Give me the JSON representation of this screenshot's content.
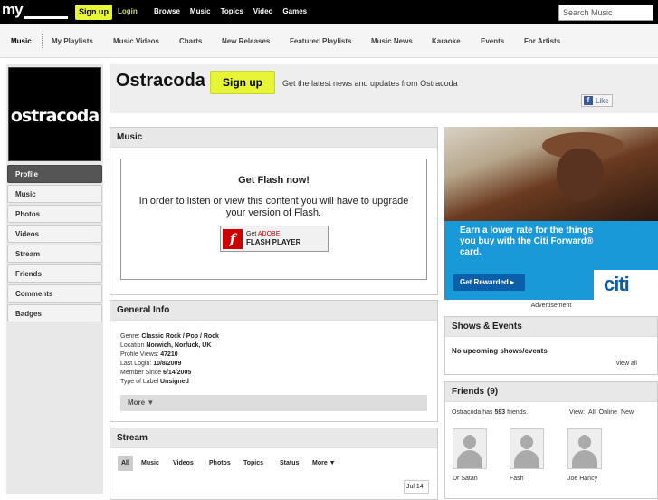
{
  "topbar": {
    "signup_label": "Sign up",
    "login_label": "Login",
    "nav": [
      "Browse",
      "Music",
      "Topics",
      "Video",
      "Games"
    ],
    "search_placeholder": "Search Music"
  },
  "subnav": [
    "Music",
    "My Playlists",
    "Music Videos",
    "Charts",
    "New Releases",
    "Featured Playlists",
    "Music News",
    "Karaoke",
    "Events",
    "For Artists"
  ],
  "sidebar": {
    "logo_text": "ostracoda",
    "items": [
      "Profile",
      "Music",
      "Photos",
      "Videos",
      "Stream",
      "Friends",
      "Comments",
      "Badges"
    ]
  },
  "header": {
    "artist": "Ostracoda",
    "signup_label": "Sign up",
    "tagline": "Get the latest news and updates from Ostracoda",
    "like_label": "Like"
  },
  "music": {
    "title": "Music",
    "flash_title": "Get Flash now!",
    "flash_body": "In order to listen or view this content you will have to upgrade your version of Flash.",
    "flash_button": {
      "line1": "Get",
      "brand": "ADOBE",
      "line2": "FLASH",
      "player": "PLAYER"
    }
  },
  "general_info": {
    "title": "General Info",
    "rows": [
      {
        "label": "Genre:",
        "value": "Classic Rock / Pop / Rock"
      },
      {
        "label": "Location",
        "value": "Norwich, Norfuck, UK"
      },
      {
        "label": "Profile Views:",
        "value": "47210"
      },
      {
        "label": "Last Login:",
        "value": "10/8/2009"
      },
      {
        "label": "Member Since",
        "value": "6/14/2005"
      },
      {
        "label": "Type of Label",
        "value": "Unsigned"
      }
    ],
    "more_label": "More ▼"
  },
  "stream": {
    "title": "Stream",
    "tabs": [
      "All",
      "Music",
      "Videos",
      "Photos",
      "Topics",
      "Status",
      "More ▼"
    ],
    "date": "Jul 14"
  },
  "ad": {
    "headline": "Earn a lower rate for the things you buy with the Citi Forward® card.",
    "button": "Get Rewarded ▸",
    "brand": "citi",
    "label": "Advertisement"
  },
  "shows": {
    "title": "Shows & Events",
    "message": "No upcoming shows/events",
    "view_all": "view all"
  },
  "friends": {
    "title": "Friends (9)",
    "count_prefix": "Ostracoda has",
    "count": "593",
    "count_suffix": "friends.",
    "view_label": "View:",
    "filters": [
      "All",
      "Online",
      "New"
    ],
    "list": [
      "Dr Satan",
      "Fash",
      "Joe Hancy"
    ]
  }
}
